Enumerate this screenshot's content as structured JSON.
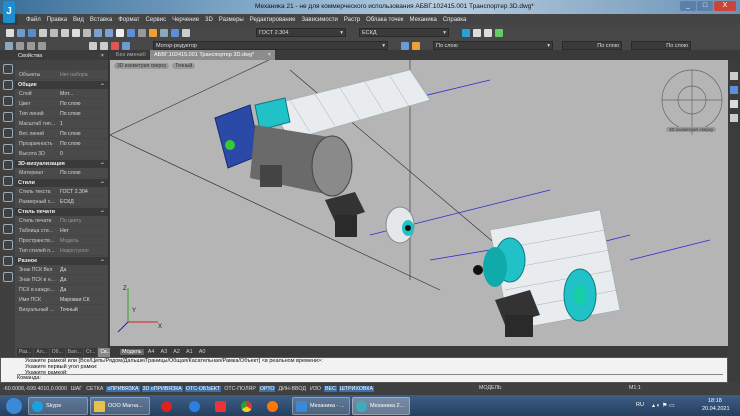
{
  "window": {
    "title": "Механика 21 - не для коммерческого использования АБВГ.102415.001 Транспортер 3D.dwg*",
    "app_icon": "app-logo",
    "buttons": [
      "_",
      "□",
      "X"
    ]
  },
  "menu": [
    "Файл",
    "Правка",
    "Вид",
    "Вставка",
    "Формат",
    "Сервис",
    "Черчение",
    "3D",
    "Размеры",
    "Редактирование",
    "Зависимости",
    "Растр",
    "Облака точек",
    "Механика",
    "Справка"
  ],
  "toolbar": {
    "text_style": "ГОСТ 2.304",
    "dim_style": "ЕСКД",
    "layer": "Мотор-редуктор",
    "color": "По слою",
    "linetype": "По слою",
    "lineweight": "По слою"
  },
  "doc_tabs": [
    {
      "label": "Без имени0"
    },
    {
      "label": "АБВГ.102415.001 Транспортер 3D.dwg*",
      "active": true
    }
  ],
  "viewport_labels": [
    "3D изометрия сверху",
    "Точный"
  ],
  "viewcube_label": "3D изометрия сверху",
  "properties": {
    "title": "Свойства",
    "objects_label": "Объекты",
    "objects_value": "Нет набора",
    "sections": [
      {
        "title": "Общие",
        "rows": [
          [
            "Слой",
            "Мот..."
          ],
          [
            "Цвет",
            "По слою"
          ],
          [
            "Тип линий",
            "По слою"
          ],
          [
            "Масштаб тип...",
            "1"
          ],
          [
            "Вес линий",
            "По слою"
          ],
          [
            "Прозрачность",
            "По слою"
          ],
          [
            "Высота 3D",
            "0"
          ]
        ]
      },
      {
        "title": "3D-визуализация",
        "rows": [
          [
            "Материал",
            "По слою"
          ]
        ]
      },
      {
        "title": "Стили",
        "rows": [
          [
            "Стиль текста",
            "ГОСТ 2.304"
          ],
          [
            "Размерный с...",
            "ЕСКД"
          ]
        ]
      },
      {
        "title": "Стиль печати",
        "rows": [
          [
            "Стиль печати",
            "По цвету"
          ],
          [
            "Таблица сти...",
            "Нет"
          ],
          [
            "Пространств...",
            "Модель"
          ],
          [
            "Тип стилей п...",
            "Недоступно"
          ]
        ]
      },
      {
        "title": "Разное",
        "rows": [
          [
            "Знак ПСК Вкл",
            "Да"
          ],
          [
            "Знак ПСК в н...",
            "Да"
          ],
          [
            "ПСК в каждо...",
            "Да"
          ],
          [
            "Имя ПСК",
            "Мировая СК"
          ],
          [
            "Визуальный ...",
            "Точный"
          ]
        ]
      }
    ],
    "bottom_tabs": [
      "Раз...",
      "Ал...",
      "Об...",
      "Бал...",
      "Ст...",
      "Св..."
    ]
  },
  "model_tabs": [
    "Модель",
    "A4",
    "A3",
    "A2",
    "A1",
    "A0"
  ],
  "command": {
    "lines": [
      "Укажите рамкой или [Все/Цепь/Рядом/Дальше/Границы/Общая/Касательная/Рамка/Объект] <в реальном времени>:",
      "Укажите первый угол рамки:",
      "Укажите рамкой:"
    ],
    "prompt": "Команда:"
  },
  "status": {
    "coords": "-60.6008,-699.4010,0.0000",
    "toggles": [
      {
        "label": "ШАГ",
        "on": false
      },
      {
        "label": "СЕТКА",
        "on": false
      },
      {
        "label": "оПРИВЯЗКА",
        "on": true
      },
      {
        "label": "3D оПРИВЯЗКА",
        "on": true
      },
      {
        "label": "ОТС-ОБЪЕКТ",
        "on": true
      },
      {
        "label": "ОТС-ПОЛЯР",
        "on": false
      },
      {
        "label": "ОРТО",
        "on": true
      },
      {
        "label": "ДИН-ВВОД",
        "on": false
      },
      {
        "label": "ИЗО",
        "on": false
      },
      {
        "label": "ВЕС",
        "on": true
      },
      {
        "label": "ШТРИХОВКА",
        "on": true
      }
    ],
    "space": "МОДЕЛЬ",
    "scale": "M1:1"
  },
  "taskbar": {
    "items": [
      "Skype",
      "ООО Магна...",
      "Механика - ...",
      "Механика 2..."
    ],
    "lang": "RU",
    "time": "18:18",
    "date": "20.04.2021"
  },
  "colors": {
    "viewport": "#b5b5b5",
    "accent_cyan": "#21c2c7",
    "gearbox_blue": "#2b4aa8",
    "axis_line": "#2a2ad0"
  }
}
